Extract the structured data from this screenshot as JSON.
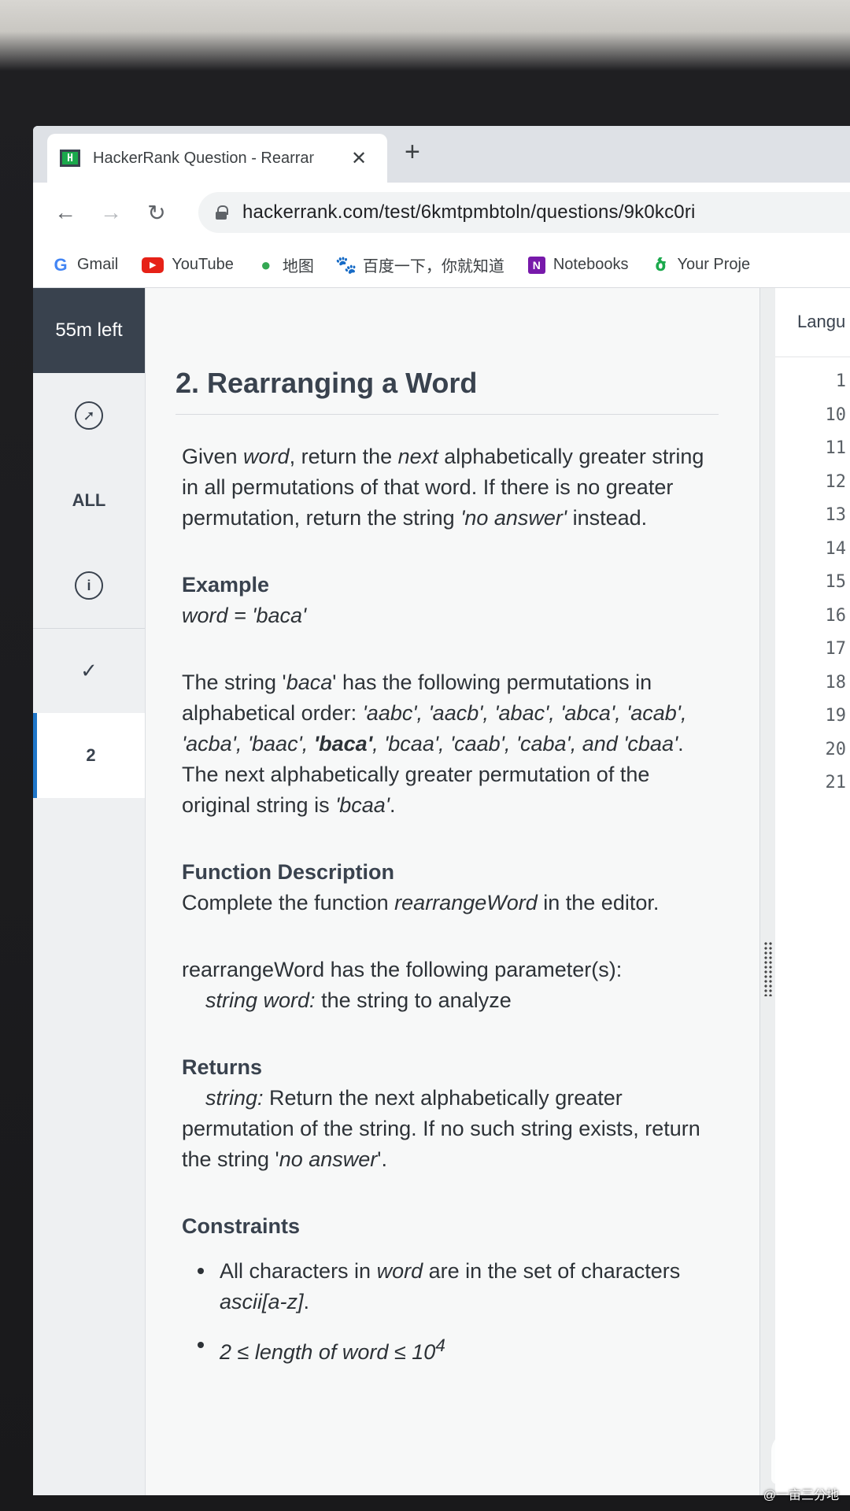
{
  "browser": {
    "tab_title": "HackerRank Question - Rearrar",
    "tab_close": "✕",
    "new_tab": "+",
    "url": "hackerrank.com/test/6kmtpmbtoln/questions/9k0kc0ri",
    "bookmarks": [
      {
        "label": "Gmail",
        "icon": "G"
      },
      {
        "label": "YouTube",
        "icon": "▶"
      },
      {
        "label": "地图",
        "icon": "●"
      },
      {
        "label": "百度一下，你就知道",
        "icon": "🐾"
      },
      {
        "label": "Notebooks",
        "icon": "N"
      },
      {
        "label": "Your Proje",
        "icon": "ծ"
      }
    ]
  },
  "sidebar": {
    "timer": "55m left",
    "all_label": "ALL",
    "info_icon": "i",
    "current_question": "2"
  },
  "question": {
    "title": "2. Rearranging a Word",
    "intro": {
      "p1": "Given ",
      "word": "word",
      "p2": ", return the ",
      "next": "next",
      "p3": " alphabetically greater string in all permutations of that word. If there is no greater permutation, return the string ",
      "no_answer": "'no answer'",
      "p4": " instead."
    },
    "example_heading": "Example",
    "example_value": "word = 'baca'",
    "explain": {
      "p1": "The string '",
      "baca": "baca",
      "p2": "' has the following permutations in alphabetical order: ",
      "list1": "'aabc', 'aacb', 'abac', 'abca', 'acab', 'acba', 'baac', ",
      "bold": "'baca'",
      "list2": ", 'bcaa', 'caab', 'caba', and 'cbaa'",
      "p3": ". The next alphabetically greater permutation of the original string is ",
      "answer": "'bcaa'",
      "p4": "."
    },
    "function_heading": "Function Description",
    "function_text_1": "Complete the function ",
    "function_name": "rearrangeWord",
    "function_text_2": " in the editor.",
    "params_intro": "rearrangeWord has the following parameter(s):",
    "param_type": "string word:",
    "param_desc": " the string to analyze",
    "returns_heading": "Returns",
    "returns_type": "string:",
    "returns_desc_1": " Return the next alphabetically greater permutation of the string. If no such string exists, return the string '",
    "returns_no_answer": "no answer",
    "returns_desc_2": "'.",
    "constraints_heading": "Constraints",
    "constraint_1a": "All characters in ",
    "constraint_1b": "word",
    "constraint_1c": " are in the set of characters ",
    "constraint_1d": "ascii[a-z]",
    "constraint_1e": ".",
    "constraint_2": "2 ≤ length of word ≤ 10",
    "constraint_2_exp": "4"
  },
  "editor": {
    "language_label": "Langu",
    "line_numbers": [
      "1",
      "10",
      "11",
      "12",
      "13",
      "14",
      "15",
      "16",
      "17",
      "18",
      "19",
      "20",
      "21"
    ],
    "fold_marker": "❯"
  },
  "watermark": "@一亩三分地"
}
